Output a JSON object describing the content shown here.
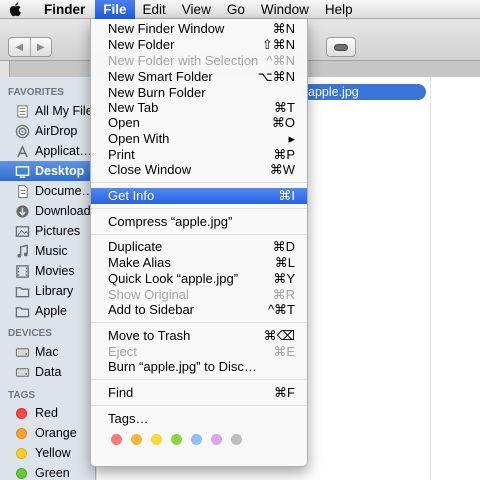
{
  "menubar": {
    "items": [
      "Finder",
      "File",
      "Edit",
      "View",
      "Go",
      "Window",
      "Help"
    ],
    "active_index": 1
  },
  "sidebar": {
    "favorites_header": "FAVORITES",
    "favorites": [
      "All My Files",
      "AirDrop",
      "Applicat…",
      "Desktop",
      "Docume…",
      "Downloads",
      "Pictures",
      "Music",
      "Movies",
      "Library",
      "Apple"
    ],
    "selected": "Desktop",
    "devices_header": "DEVICES",
    "devices": [
      "Mac",
      "Data"
    ],
    "tags_header": "TAGS",
    "tags": [
      {
        "label": "Red",
        "color": "#f44b47"
      },
      {
        "label": "Orange",
        "color": "#f7a430"
      },
      {
        "label": "Yellow",
        "color": "#f4d02b"
      },
      {
        "label": "Green",
        "color": "#68c73a"
      }
    ]
  },
  "content": {
    "selected_file": "apple.jpg"
  },
  "file_menu": {
    "items": [
      {
        "label": "New Finder Window",
        "shortcut": "⌘N"
      },
      {
        "label": "New Folder",
        "shortcut": "⇧⌘N"
      },
      {
        "label": "New Folder with Selection",
        "shortcut": "^⌘N",
        "disabled": true
      },
      {
        "label": "New Smart Folder",
        "shortcut": "⌥⌘N"
      },
      {
        "label": "New Burn Folder",
        "shortcut": ""
      },
      {
        "label": "New Tab",
        "shortcut": "⌘T"
      },
      {
        "label": "Open",
        "shortcut": "⌘O"
      },
      {
        "label": "Open With",
        "shortcut": "▸"
      },
      {
        "label": "Print",
        "shortcut": "⌘P"
      },
      {
        "label": "Close Window",
        "shortcut": "⌘W"
      },
      {
        "label": "Get Info",
        "shortcut": "⌘I",
        "highlighted": true
      },
      {
        "label": "Compress “apple.jpg”",
        "shortcut": ""
      },
      {
        "label": "Duplicate",
        "shortcut": "⌘D"
      },
      {
        "label": "Make Alias",
        "shortcut": "⌘L"
      },
      {
        "label": "Quick Look “apple.jpg”",
        "shortcut": "⌘Y"
      },
      {
        "label": "Show Original",
        "shortcut": "⌘R",
        "disabled": true
      },
      {
        "label": "Add to Sidebar",
        "shortcut": "^⌘T"
      },
      {
        "label": "Move to Trash",
        "shortcut": "⌘⌫"
      },
      {
        "label": "Eject",
        "shortcut": "⌘E",
        "disabled": true
      },
      {
        "label": "Burn “apple.jpg” to Disc…",
        "shortcut": ""
      },
      {
        "label": "Find",
        "shortcut": "⌘F"
      },
      {
        "label": "Tags…",
        "shortcut": ""
      }
    ],
    "tag_colors": [
      "#f47a78",
      "#f7b23f",
      "#f5d93a",
      "#8dd43f",
      "#8fbff5",
      "#dba5ec",
      "#bdbdbd"
    ]
  }
}
